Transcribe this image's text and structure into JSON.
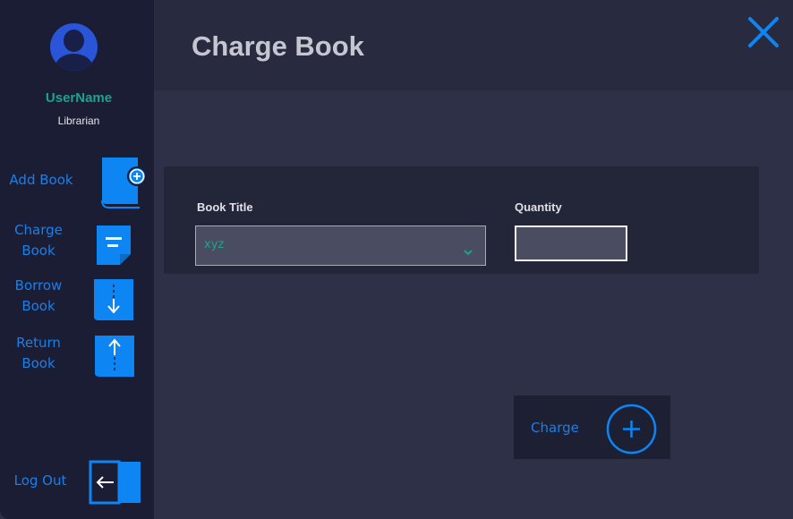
{
  "sidebar": {
    "username": "UserName",
    "role": "Librarian",
    "items": [
      {
        "label_line1": "Add Book",
        "label_line2": ""
      },
      {
        "label_line1": "Charge",
        "label_line2": "Book"
      },
      {
        "label_line1": "Borrow",
        "label_line2": "Book"
      },
      {
        "label_line1": "Return",
        "label_line2": "Book"
      }
    ],
    "logout_label": "Log Out"
  },
  "header": {
    "title": "Charge Book"
  },
  "form": {
    "book_title_label": "Book Title",
    "book_title_value": "xyz",
    "quantity_label": "Quantity",
    "quantity_value": ""
  },
  "actions": {
    "charge_label": "Charge"
  },
  "colors": {
    "accent": "#0d85f2",
    "username": "#19a58c",
    "sidebar_bg": "#1b1d35",
    "main_bg": "#2e3047"
  }
}
